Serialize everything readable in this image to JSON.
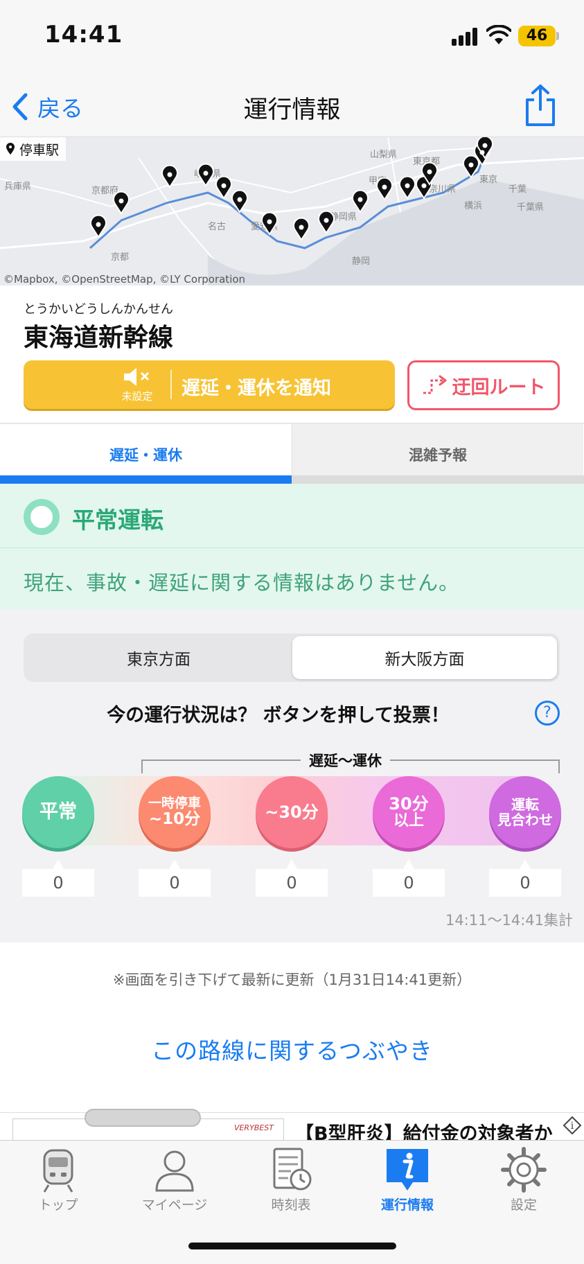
{
  "status_bar": {
    "time": "14:41",
    "battery": "46"
  },
  "nav": {
    "back_label": "戻る",
    "title": "運行情報"
  },
  "map": {
    "chip_label": "停車駅",
    "credit": "©Mapbox, ©OpenStreetMap, ©LY Corporation",
    "place_labels": [
      "兵庫県",
      "京都府",
      "京都",
      "岐阜県",
      "名古",
      "愛知県",
      "静岡県",
      "静岡",
      "山梨県",
      "甲府",
      "東京都",
      "東京",
      "神奈川県",
      "横浜",
      "千葉",
      "千葉県"
    ]
  },
  "line": {
    "furigana": "とうかいどうしんかんせん",
    "name": "東海道新幹線",
    "notify_unset": "未設定",
    "notify_label": "遅延・運休を通知",
    "detour_label": "迂回ルート"
  },
  "tabs": {
    "delay": "遅延・運休",
    "crowd": "混雑予報"
  },
  "status": {
    "title": "平常運転",
    "message": "現在、事故・遅延に関する情報はありません。"
  },
  "vote": {
    "direction_left": "東京方面",
    "direction_right": "新大阪方面",
    "question": "今の運行状況は？ ボタンを押して投票！",
    "help": "?",
    "range_label": "遅延〜運休",
    "options": [
      {
        "line1": "平常",
        "line2": "",
        "count": "0",
        "color": "#5fd0a8"
      },
      {
        "line1": "一時停車",
        "line2": "~10分",
        "count": "0",
        "color": "#fb8a70"
      },
      {
        "line1": "~30分",
        "line2": "",
        "count": "0",
        "color": "#f97c8e"
      },
      {
        "line1": "30分",
        "line2": "以上",
        "count": "0",
        "color": "#ea6ad8"
      },
      {
        "line1": "運転",
        "line2": "見合わせ",
        "count": "0",
        "color": "#cf6ae0"
      }
    ],
    "tally": "14:11～14:41集計"
  },
  "footer": {
    "refresh_note": "※画面を引き下げて最新に更新（1月31日14:41更新）",
    "tweets_link": "この路線に関するつぶやき"
  },
  "ad": {
    "brand": "VERYBEST",
    "text": "【B型肝炎】給付金の対象者か"
  },
  "tabbar": {
    "items": [
      {
        "label": "トップ",
        "icon": "train-icon"
      },
      {
        "label": "マイページ",
        "icon": "person-icon"
      },
      {
        "label": "時刻表",
        "icon": "timetable-icon"
      },
      {
        "label": "運行情報",
        "icon": "info-icon"
      },
      {
        "label": "設定",
        "icon": "gear-icon"
      }
    ],
    "active_index": 3
  },
  "colors": {
    "accent": "#1a7cf0",
    "notify": "#f7c335",
    "detour": "#f0566a",
    "normal": "#2aa876"
  }
}
